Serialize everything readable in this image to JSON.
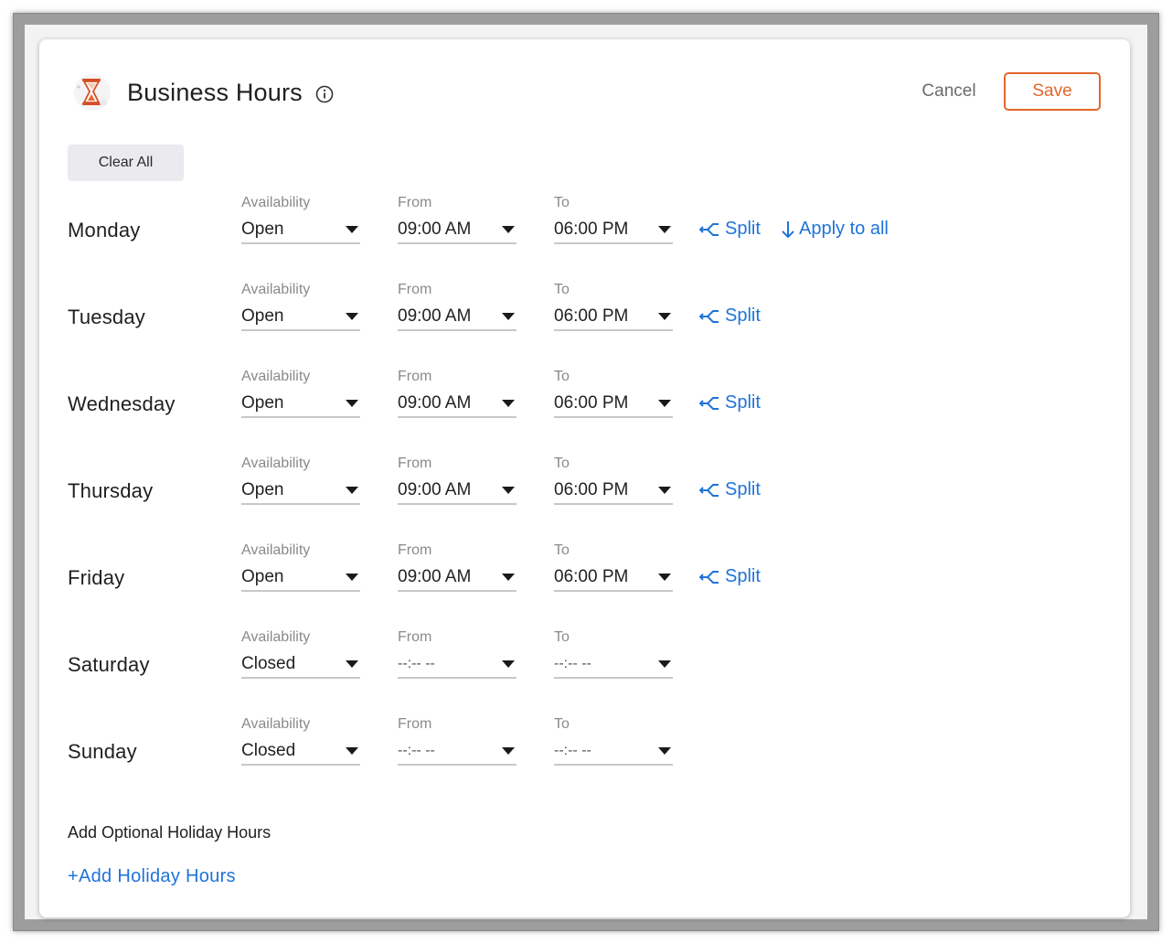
{
  "header": {
    "title": "Business Hours",
    "cancel_label": "Cancel",
    "save_label": "Save",
    "accent_color": "#e3672d",
    "logo_icon": "hourglass-logo-icon",
    "info_icon": "info-icon"
  },
  "toolbar": {
    "clear_all_label": "Clear All"
  },
  "labels": {
    "availability": "Availability",
    "from": "From",
    "to": "To"
  },
  "links": {
    "split": "Split",
    "apply_to_all": "Apply to all",
    "link_color": "#1f73d8"
  },
  "days": [
    {
      "name": "Monday",
      "availability": "Open",
      "from": "09:00 AM",
      "to": "06:00 PM"
    },
    {
      "name": "Tuesday",
      "availability": "Open",
      "from": "09:00 AM",
      "to": "06:00 PM"
    },
    {
      "name": "Wednesday",
      "availability": "Open",
      "from": "09:00 AM",
      "to": "06:00 PM"
    },
    {
      "name": "Thursday",
      "availability": "Open",
      "from": "09:00 AM",
      "to": "06:00 PM"
    },
    {
      "name": "Friday",
      "availability": "Open",
      "from": "09:00 AM",
      "to": "06:00 PM"
    },
    {
      "name": "Saturday",
      "availability": "Closed",
      "from": "--:-- --",
      "to": "--:-- --"
    },
    {
      "name": "Sunday",
      "availability": "Closed",
      "from": "--:-- --",
      "to": "--:-- --"
    }
  ],
  "holiday": {
    "section_label": "Add Optional Holiday Hours",
    "add_label": "+Add Holiday Hours"
  }
}
